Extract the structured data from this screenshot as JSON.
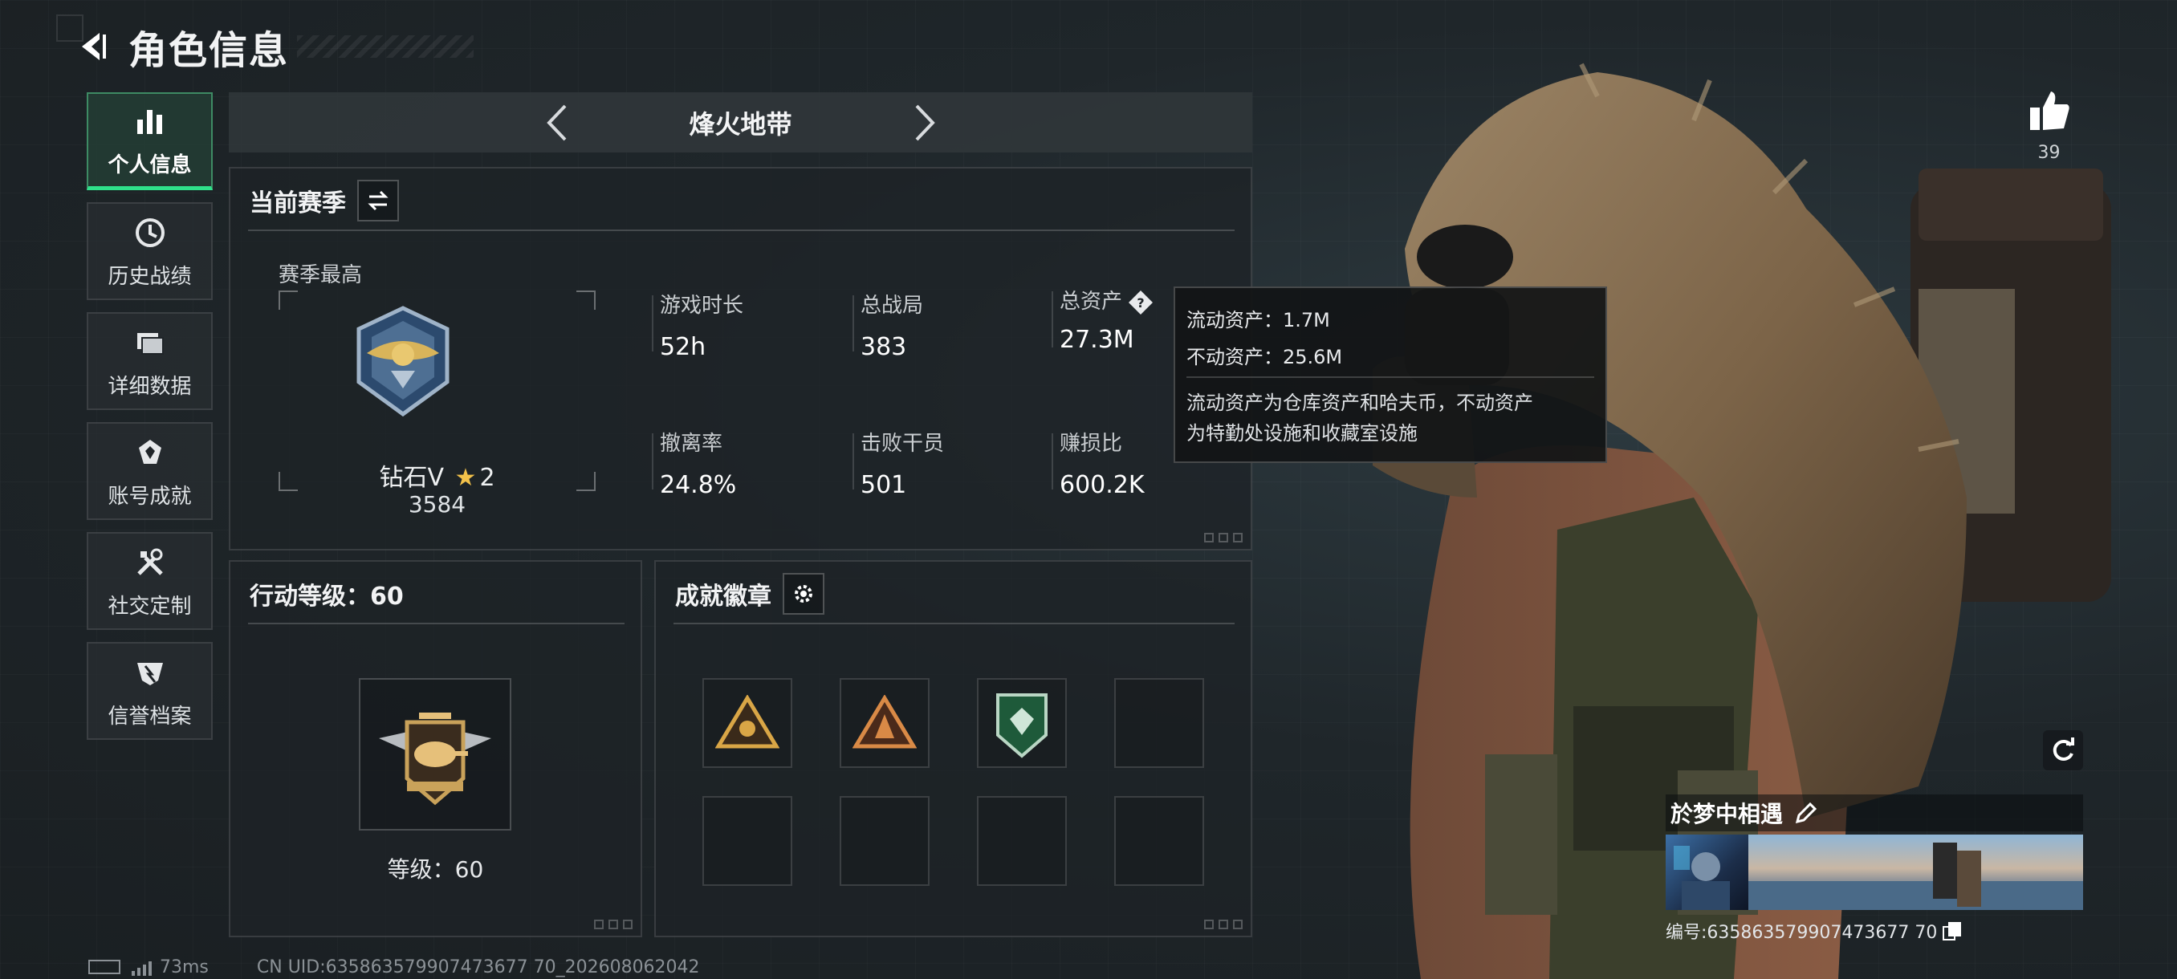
{
  "header": {
    "title": "角色信息"
  },
  "sidebar": {
    "items": [
      {
        "label": "个人信息",
        "icon": "bar-chart-icon",
        "active": true
      },
      {
        "label": "历史战绩",
        "icon": "clock-icon",
        "active": false
      },
      {
        "label": "详细数据",
        "icon": "folder-icon",
        "active": false
      },
      {
        "label": "账号成就",
        "icon": "achievement-icon",
        "active": false
      },
      {
        "label": "社交定制",
        "icon": "tools-icon",
        "active": false
      },
      {
        "label": "信誉档案",
        "icon": "reputation-icon",
        "active": false
      }
    ]
  },
  "mode": {
    "title": "烽火地带"
  },
  "season": {
    "title": "当前赛季",
    "best_label": "赛季最高",
    "rank_name": "钻石V",
    "rank_stars": "2",
    "rank_score": "3584",
    "stats": [
      {
        "label": "游戏时长",
        "value": "52h"
      },
      {
        "label": "总战局",
        "value": "383"
      },
      {
        "label": "总资产",
        "value": "27.3M"
      },
      {
        "label": "撤离率",
        "value": "24.8%"
      },
      {
        "label": "击败干员",
        "value": "501"
      },
      {
        "label": "赚损比",
        "value": "600.2K"
      }
    ]
  },
  "tooltip": {
    "liquid": "流动资产：1.7M",
    "fixed": "不动资产：25.6M",
    "desc_line1": "流动资产为仓库资产和哈夫币，不动资产",
    "desc_line2": "为特勤处设施和收藏室设施"
  },
  "level": {
    "title": "行动等级：60",
    "label": "等级：60"
  },
  "achievement": {
    "title": "成就徽章"
  },
  "player": {
    "name": "於梦中相遇",
    "id": "编号:635863579907473677 70",
    "likes": "39"
  },
  "footer": {
    "ping": "73ms",
    "uid": "CN UID:635863579907473677 70_202608062042"
  },
  "colors": {
    "accent": "#2fe08a",
    "panel": "#1e2326",
    "gold": "#f2c14a"
  }
}
